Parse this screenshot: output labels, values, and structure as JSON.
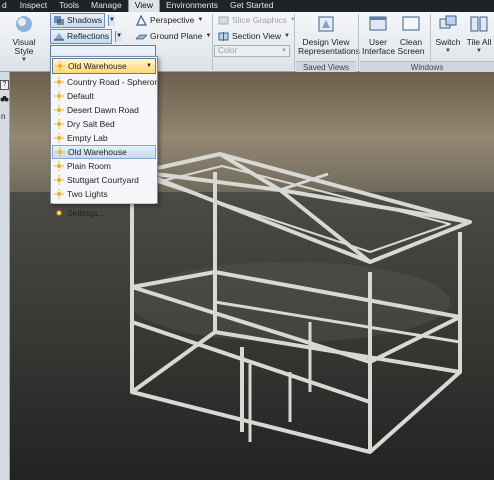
{
  "menu_tabs": [
    "d",
    "Inspect",
    "Tools",
    "Manage",
    "View",
    "Environments",
    "Get Started"
  ],
  "active_tab_index": 4,
  "ribbon": {
    "visual_style": {
      "label": "Visual Style"
    },
    "shadows": {
      "label": "Shadows"
    },
    "reflections": {
      "label": "Reflections"
    },
    "environment_selected": "Old Warehouse",
    "perspective": {
      "label": "Perspective"
    },
    "ground_plane": {
      "label": "Ground Plane"
    },
    "slice_graphics": {
      "label": "Slice Graphics"
    },
    "section_view": {
      "label": "Section View"
    },
    "color_select": {
      "placeholder": "Color"
    },
    "design_view_reps": {
      "line1": "Design View",
      "line2": "Representations"
    },
    "saved_views_group": "Saved Views",
    "user_interface": {
      "line1": "User",
      "line2": "Interface"
    },
    "clean_screen": {
      "line1": "Clean",
      "line2": "Screen"
    },
    "switch": {
      "label": "Switch"
    },
    "tile_all": {
      "label": "Tile All"
    },
    "windows_group": "Windows"
  },
  "left_panel": {
    "help": "?",
    "label": "n"
  },
  "dropdown": {
    "items": [
      "Country Road - SpheronVR",
      "Default",
      "Desert Dawn Road",
      "Dry Salt Bed",
      "Empty Lab",
      "Old Warehouse",
      "Plain Room",
      "Stuttgart Courtyard",
      "Two Lights"
    ],
    "selected_index": 5,
    "settings_label": "Settings..."
  },
  "colors": {
    "accent_blue": "#5c7ea9",
    "highlight_gold": "#ffd977",
    "sun_icon": "#f0b324"
  }
}
